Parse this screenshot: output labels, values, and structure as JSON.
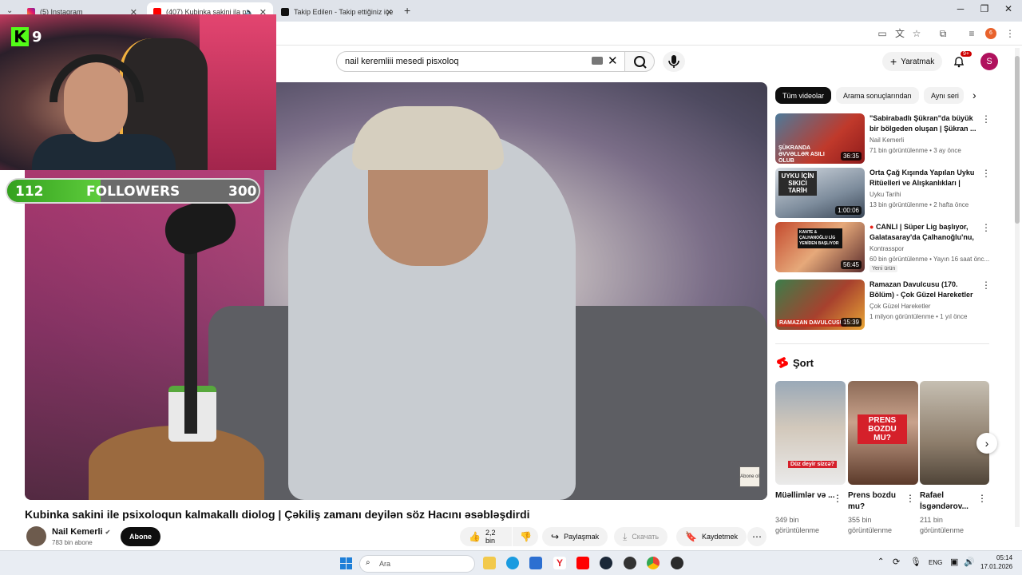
{
  "browser": {
    "tabs": [
      {
        "label": "(5) Instagram",
        "active": false
      },
      {
        "label": "(407) Kubinka sakini ila psixo",
        "active": true
      },
      {
        "label": "Takip Edilen - Takip ettiğiniz içe",
        "active": false
      }
    ],
    "new_tab": "+"
  },
  "masthead": {
    "search_value": "nail keremliii mesedi pisxoloq",
    "create_label": "Yaratmak",
    "notif_count": "9+",
    "avatar_letter": "S"
  },
  "overlay": {
    "kick_count": "9",
    "followers_current": "112",
    "followers_label": "FOLLOWERS",
    "followers_goal": "300",
    "followers_progress": 0.373,
    "player_badge": "Abone ol"
  },
  "video": {
    "title": "Kubinka sakini ile psixoloqun kalmakallı diolog | Çəkiliş zamanı deyilən söz Hacını əsəbləşdirdi",
    "channel_name": "Nail Kemerli",
    "channel_subs": "783 bin abone",
    "subscribe_label": "Abone",
    "likes": "2,2 bin",
    "share_label": "Paylaşmak",
    "download_label": "Скачать",
    "save_label": "Kaydetmek"
  },
  "chips": [
    "Tüm videolar",
    "Arama sonuçlarından",
    "Aynı seri"
  ],
  "recommendations": [
    {
      "title": "\"Sabirabadlı Şükran\"da büyük bir bölgeden oluşan | Şükran ...",
      "channel": "Nail Kemerli",
      "meta": "71 bin görüntülenme • 3 ay önce",
      "duration": "36:35",
      "thumb_text": "ŞÜKRANDA ƏVVƏLLƏR ASILI OLUB",
      "badge": ""
    },
    {
      "title": "Orta Çağ Kışında Yapılan Uyku Ritüelleri ve Alışkanlıkları | Uyk...",
      "channel": "Uyku Tarihi",
      "meta": "13 bin görüntülenme • 2 hafta önce",
      "duration": "1:00:06",
      "thumb_text": "UYKU İÇİN SIKICI TARİH",
      "badge": ""
    },
    {
      "title": "CANLI | Süper Lig başlıyor, Galatasaray'da Çalhanoğlu'nu, ...",
      "channel": "Kontrasspor",
      "meta": "60 bin görüntülenme • Yayın 16 saat önc...",
      "duration": "56:45",
      "thumb_text": "KANTE & ÇALHANOĞLU LİG YENİDEN BAŞLIYOR",
      "badge": "Yeni ürün"
    },
    {
      "title": "Ramazan Davulcusu (170. Bölüm) - Çok Güzel Hareketler 2",
      "channel": "Çok Güzel Hareketler",
      "meta": "1 milyon görüntülenme • 1 yıl önce",
      "duration": "15:39",
      "thumb_text": "RAMAZAN DAVULCUSU",
      "badge": ""
    }
  ],
  "shorts": {
    "heading": "Şort",
    "items": [
      {
        "title": "Müəllimlər və ...",
        "views": "349 bin görüntülenme",
        "overlay": "Düz deyir sizcə?"
      },
      {
        "title": "Prens bozdu mu?",
        "views": "355 bin görüntülenme",
        "overlay": "PRENS BOZDU MU?"
      },
      {
        "title": "Rafael İsgəndərov...",
        "views": "211 bin görüntülenme",
        "overlay": ""
      }
    ]
  },
  "taskbar": {
    "search_placeholder": "Ara",
    "lang": "ENG",
    "time": "05:14",
    "date": "17.01.2026"
  },
  "colors": {
    "youtube_red": "#ff0000",
    "kick_green": "#53fc18",
    "subscribe_black": "#0f0f0f"
  }
}
